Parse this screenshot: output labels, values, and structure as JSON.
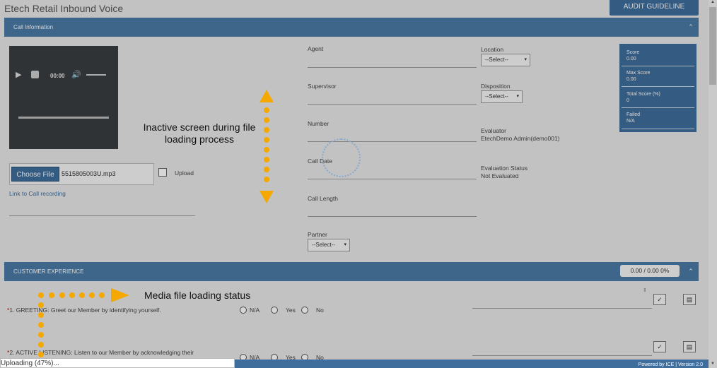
{
  "app": {
    "title": "Etech Retail Inbound Voice",
    "audit_button": "AUDIT GUIDELINE"
  },
  "sections": {
    "call_info": "Call Information",
    "customer_experience": "CUSTOMER EXPERIENCE"
  },
  "player": {
    "time": "00:00"
  },
  "file": {
    "choose_label": "Choose File",
    "filename": "5515805003U.mp3",
    "upload_label": "Upload",
    "link_label": "Link to Call recording"
  },
  "fields": {
    "agent": "Agent",
    "supervisor": "Supervisor",
    "number": "Number",
    "call_date": "Call Date",
    "call_length": "Call Length",
    "partner": "Partner",
    "location": "Location",
    "disposition": "Disposition",
    "evaluator_label": "Evaluator",
    "evaluator_value": "EtechDemo Admin(demo001)",
    "eval_status_label": "Evaluation Status",
    "eval_status_value": "Not Evaluated"
  },
  "select_placeholder": "--Select--",
  "score_panel": {
    "score_label": "Score",
    "score_value": "0.00",
    "max_label": "Max Score",
    "max_value": "0.00",
    "total_label": "Total Score (%)",
    "total_value": "0",
    "failed_label": "Failed",
    "failed_value": "N/A"
  },
  "section_score": "0.00  /  0.00  0%",
  "questions": [
    {
      "num": "*",
      "text": "1. GREETING: Greet our Member by identifying yourself."
    },
    {
      "num": "*",
      "text": "2. ACTIVE LISTENING: Listen to our Member by acknowledging their"
    }
  ],
  "radio_options": {
    "na": "N/A",
    "yes": "Yes",
    "no": "No"
  },
  "annotations": {
    "inactive": "Inactive screen during file loading process",
    "media_status": "Media file loading status"
  },
  "status": {
    "uploading": "Uploading (47%)..."
  },
  "footer": "Powered by ICE | Version 2.0"
}
